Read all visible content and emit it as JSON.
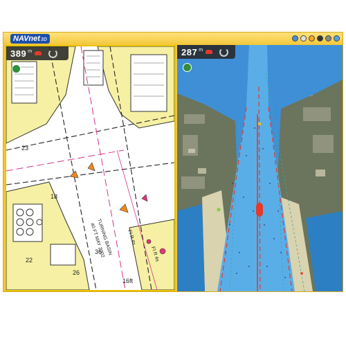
{
  "app": {
    "logo": "NAVnet",
    "logo_sub": "3D"
  },
  "tray_icons": [
    "globe-icon",
    "settings-icon",
    "sun-icon",
    "boat-icon",
    "wind-icon",
    "window-icon"
  ],
  "left_pane": {
    "range_value": "389",
    "range_unit": "m",
    "chart_labels": [
      "TURNING BASIN",
      "40 FT MAY 2002",
      "FI R 4s",
      "FI R 4s",
      "16ft",
      "36",
      "22",
      "23",
      "18",
      "26"
    ]
  },
  "right_pane": {
    "range_value": "287",
    "range_unit": "m"
  },
  "colors": {
    "app_frame": "#f3c73a",
    "chart_land": "#f6f0a4",
    "chart_water": "#ffffff",
    "satellite_water": "#3f8fd6",
    "channel": "#5aaee8",
    "vessel": "#e23a2c"
  }
}
